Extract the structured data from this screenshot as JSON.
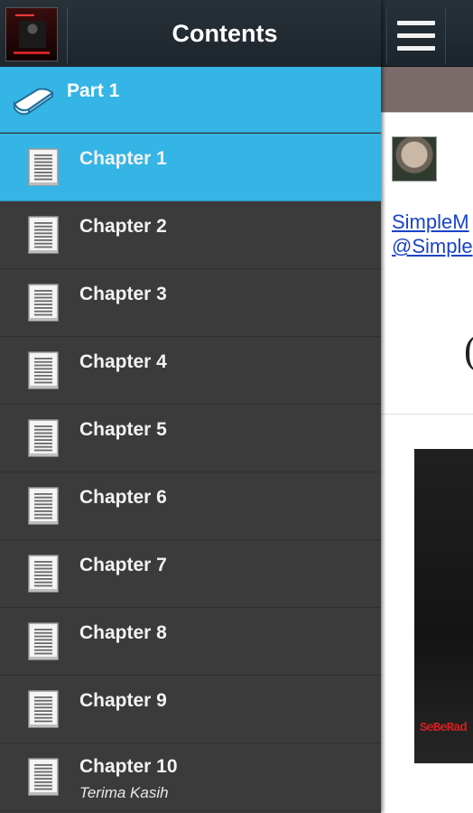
{
  "drawer": {
    "title": "Contents",
    "part": {
      "label": "Part 1"
    },
    "chapters": [
      {
        "label": "Chapter 1",
        "active": true
      },
      {
        "label": "Chapter 2"
      },
      {
        "label": "Chapter 3"
      },
      {
        "label": "Chapter 4"
      },
      {
        "label": "Chapter 5"
      },
      {
        "label": "Chapter 6"
      },
      {
        "label": "Chapter 7"
      },
      {
        "label": "Chapter 8"
      },
      {
        "label": "Chapter 9"
      },
      {
        "label": "Chapter 10",
        "subtitle": "Terima Kasih"
      }
    ]
  },
  "content": {
    "author_link_line1": "SimpleM",
    "author_link_line2": "@Simple",
    "heading_char": "(",
    "image_tag": "SeBeRad"
  },
  "icons": {
    "menu": "hamburger-menu-icon",
    "book": "book-icon",
    "chapter": "document-icon"
  },
  "colors": {
    "highlight": "#35b5e5",
    "drawer_bg": "#3b3b3b",
    "header_bg": "#1e262d",
    "link": "#1a43c8"
  }
}
